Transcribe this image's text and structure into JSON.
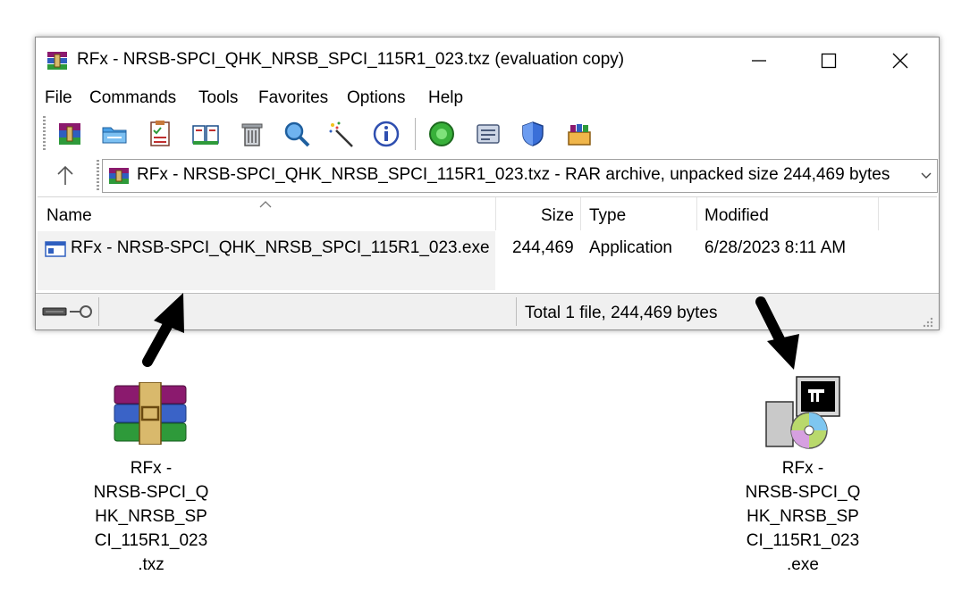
{
  "window": {
    "title": "RFx - NRSB-SPCI_QHK_NRSB_SPCI_115R1_023.txz (evaluation copy)",
    "minimize_glyph": "—",
    "close_glyph": "✕"
  },
  "menu": [
    "File",
    "Commands",
    "Tools",
    "Favorites",
    "Options",
    "Help"
  ],
  "toolbar": {
    "icons": [
      "add-icon",
      "extract-to-icon",
      "test-icon",
      "view-icon",
      "delete-icon",
      "find-icon",
      "wizard-icon",
      "info-icon",
      "virus-scan-icon",
      "comment-icon",
      "protect-icon",
      "sfx-icon"
    ]
  },
  "address": {
    "up_glyph": "↑",
    "text": "RFx - NRSB-SPCI_QHK_NRSB_SPCI_115R1_023.txz - RAR archive, unpacked size 244,469 bytes",
    "dropdown_glyph": "⌄"
  },
  "file_list": {
    "columns": [
      "Name",
      "Size",
      "Type",
      "Modified"
    ],
    "rows": [
      {
        "name": "RFx - NRSB-SPCI_QHK_NRSB_SPCI_115R1_023.exe",
        "size": "244,469",
        "type": "Application",
        "modified": "6/28/2023 8:11 AM"
      }
    ]
  },
  "status": {
    "text": "Total 1 file, 244,469 bytes"
  },
  "desktop": {
    "archive": {
      "label": [
        "RFx -",
        "NRSB-SPCI_Q",
        "HK_NRSB_SP",
        "CI_115R1_023",
        ".txz"
      ]
    },
    "executable": {
      "label": [
        "RFx -",
        "NRSB-SPCI_Q",
        "HK_NRSB_SP",
        "CI_115R1_023",
        ".exe"
      ]
    }
  },
  "colors": {
    "selection": "#f2f2f2",
    "statusbar": "#f0f0f0",
    "arrow": "#000000"
  }
}
